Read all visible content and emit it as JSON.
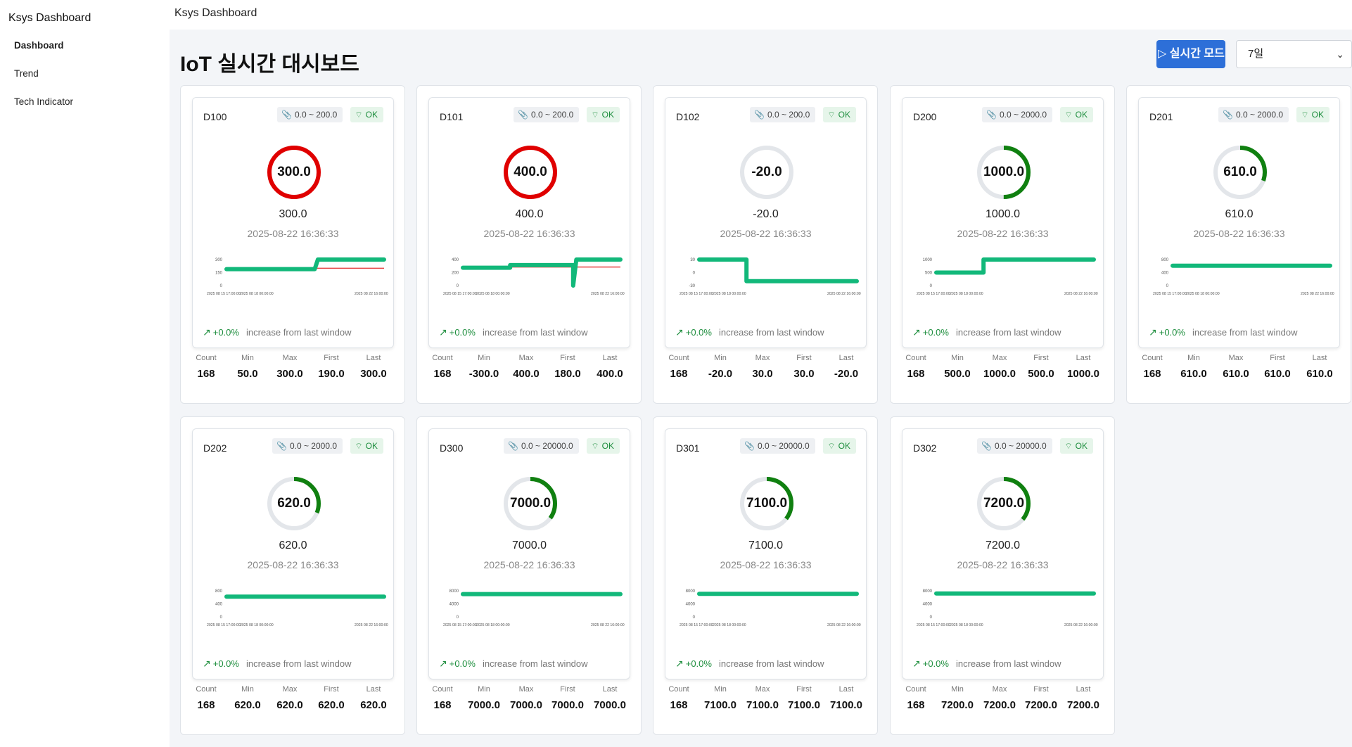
{
  "app": {
    "brand": "Ksys Dashboard",
    "topbar_title": "Ksys Dashboard"
  },
  "sidebar": {
    "items": [
      {
        "label": "Dashboard",
        "active": true
      },
      {
        "label": "Trend",
        "active": false
      },
      {
        "label": "Tech Indicator",
        "active": false
      }
    ]
  },
  "header": {
    "title": "IoT 실시간 대시보드",
    "realtime_button": "▷ 실시간 모드",
    "period": "7일"
  },
  "common": {
    "timestamp": "2025-08-22 16:36:33",
    "status": "OK",
    "trend_pct": "+0.0%",
    "trend_note": "increase from last window",
    "x_ticks": [
      "2025 08 15 17:00:00",
      "2025 08 18 00:00:00",
      "2025 08 22 16:00:00"
    ],
    "stat_labels": [
      "Count",
      "Min",
      "Max",
      "First",
      "Last"
    ],
    "colors": {
      "alarm": "#e00000",
      "normal": "#108010",
      "track": "#e3e6ea",
      "series": "#12b87a",
      "limit": "#e64545",
      "accent": "#2d6fd8"
    }
  },
  "cards": [
    {
      "id": "D100",
      "range": "0.0 ~ 200.0",
      "min": 0,
      "max": 200,
      "value": "300.0",
      "alarm": true,
      "fill": 1,
      "y_ticks": [
        "300",
        "150",
        "0"
      ],
      "stats": [
        "168",
        "50.0",
        "300.0",
        "190.0",
        "300.0"
      ],
      "series": [
        [
          0,
          190
        ],
        [
          0.56,
          190
        ],
        [
          0.58,
          300
        ],
        [
          1,
          300
        ]
      ],
      "limit": [
        [
          0,
          200
        ],
        [
          1,
          200
        ]
      ],
      "ylim": [
        0,
        300
      ]
    },
    {
      "id": "D101",
      "range": "0.0 ~ 200.0",
      "min": 0,
      "max": 200,
      "value": "400.0",
      "alarm": true,
      "fill": 1,
      "y_ticks": [
        "400",
        "200",
        "0"
      ],
      "stats": [
        "168",
        "-300.0",
        "400.0",
        "180.0",
        "400.0"
      ],
      "series": [
        [
          0,
          180
        ],
        [
          0.3,
          180
        ],
        [
          0.3,
          250
        ],
        [
          0.7,
          250
        ],
        [
          0.7,
          -300
        ],
        [
          0.72,
          400
        ],
        [
          1,
          400
        ]
      ],
      "limit": [
        [
          0,
          200
        ],
        [
          1,
          200
        ]
      ],
      "ylim": [
        -300,
        400
      ]
    },
    {
      "id": "D102",
      "range": "0.0 ~ 200.0",
      "min": 0,
      "max": 200,
      "value": "-20.0",
      "alarm": false,
      "fill": 0,
      "y_ticks": [
        "30",
        "0",
        "-30"
      ],
      "stats": [
        "168",
        "-20.0",
        "30.0",
        "30.0",
        "-20.0"
      ],
      "series": [
        [
          0,
          30
        ],
        [
          0.3,
          30
        ],
        [
          0.3,
          -20
        ],
        [
          1,
          -20
        ]
      ],
      "ylim": [
        -30,
        30
      ]
    },
    {
      "id": "D200",
      "range": "0.0 ~ 2000.0",
      "min": 0,
      "max": 2000,
      "value": "1000.0",
      "alarm": false,
      "fill": 0.5,
      "y_ticks": [
        "1000",
        "500",
        "0"
      ],
      "stats": [
        "168",
        "500.0",
        "1000.0",
        "500.0",
        "1000.0"
      ],
      "series": [
        [
          0,
          500
        ],
        [
          0.3,
          500
        ],
        [
          0.3,
          1000
        ],
        [
          1,
          1000
        ]
      ],
      "ylim": [
        0,
        1000
      ]
    },
    {
      "id": "D201",
      "range": "0.0 ~ 2000.0",
      "min": 0,
      "max": 2000,
      "value": "610.0",
      "alarm": false,
      "fill": 0.305,
      "y_ticks": [
        "800",
        "400",
        "0"
      ],
      "stats": [
        "168",
        "610.0",
        "610.0",
        "610.0",
        "610.0"
      ],
      "series": [
        [
          0,
          610
        ],
        [
          1,
          610
        ]
      ],
      "ylim": [
        0,
        800
      ]
    },
    {
      "id": "D202",
      "range": "0.0 ~ 2000.0",
      "min": 0,
      "max": 2000,
      "value": "620.0",
      "alarm": false,
      "fill": 0.31,
      "y_ticks": [
        "800",
        "400",
        "0"
      ],
      "stats": [
        "168",
        "620.0",
        "620.0",
        "620.0",
        "620.0"
      ],
      "series": [
        [
          0,
          620
        ],
        [
          1,
          620
        ]
      ],
      "ylim": [
        0,
        800
      ]
    },
    {
      "id": "D300",
      "range": "0.0 ~ 20000.0",
      "min": 0,
      "max": 20000,
      "value": "7000.0",
      "alarm": false,
      "fill": 0.35,
      "y_ticks": [
        "8000",
        "4000",
        "0"
      ],
      "stats": [
        "168",
        "7000.0",
        "7000.0",
        "7000.0",
        "7000.0"
      ],
      "series": [
        [
          0,
          7000
        ],
        [
          1,
          7000
        ]
      ],
      "ylim": [
        0,
        8000
      ]
    },
    {
      "id": "D301",
      "range": "0.0 ~ 20000.0",
      "min": 0,
      "max": 20000,
      "value": "7100.0",
      "alarm": false,
      "fill": 0.355,
      "y_ticks": [
        "8000",
        "4000",
        "0"
      ],
      "stats": [
        "168",
        "7100.0",
        "7100.0",
        "7100.0",
        "7100.0"
      ],
      "series": [
        [
          0,
          7100
        ],
        [
          1,
          7100
        ]
      ],
      "ylim": [
        0,
        8000
      ]
    },
    {
      "id": "D302",
      "range": "0.0 ~ 20000.0",
      "min": 0,
      "max": 20000,
      "value": "7200.0",
      "alarm": false,
      "fill": 0.36,
      "y_ticks": [
        "8000",
        "4000",
        "0"
      ],
      "stats": [
        "168",
        "7200.0",
        "7200.0",
        "7200.0",
        "7200.0"
      ],
      "series": [
        [
          0,
          7200
        ],
        [
          1,
          7200
        ]
      ],
      "ylim": [
        0,
        8000
      ]
    }
  ]
}
